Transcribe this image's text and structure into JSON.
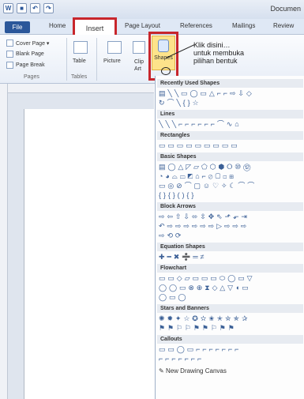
{
  "title_bar": {
    "document_title": "Documen"
  },
  "tabs": {
    "file": "File",
    "home": "Home",
    "insert": "Insert",
    "page_layout": "Page Layout",
    "references": "References",
    "mailings": "Mailings",
    "review": "Review"
  },
  "pages_group": {
    "cover_page": "Cover Page ▾",
    "blank_page": "Blank Page",
    "page_break": "Page Break",
    "group": "Pages"
  },
  "tables_group": {
    "table": "Table",
    "group": "Tables"
  },
  "illustrations": {
    "picture": "Picture",
    "clip_art": "Clip Art",
    "shapes": "Shapes"
  },
  "annotation": {
    "line1": "Klik disini…",
    "line2": "untuk membuka",
    "line3": "pilihan bentuk"
  },
  "gallery": {
    "sections": [
      {
        "title": "Recently Used Shapes",
        "rows": [
          "▤ ╲ ╲ ▭ ◯ ▭ △ ⌐ ⌐ ⇨ ⇩ ◇",
          "↻ ⌒ ╲ { } ☆"
        ]
      },
      {
        "title": "Lines",
        "rows": [
          "╲ ╲ ╲ ⌐ ⌐ ⌐ ⌐ ⌐ ⌐ ⌒ ∿ ⌂"
        ]
      },
      {
        "title": "Rectangles",
        "rows": [
          "▭ ▭ ▭ ▭ ▭ ▭ ▭ ▭ ▭"
        ]
      },
      {
        "title": "Basic Shapes",
        "rows": [
          "▤ ◯ △ ◸ ▱ ⬠ ⬡ ⬢ ⭘ ⑩ ⑫",
          "◔ ◕ ⌓ ▭ ◩ ⌂ ⌐ ⊘ ▢ ◻ ⊞",
          "▭ ◎ ⊘ ⌒ ▢ ☺ ♡ ✧ ☾ ⌒ ⌒",
          "{ } { } ( ) { }"
        ]
      },
      {
        "title": "Block Arrows",
        "rows": [
          "⇨ ⇦ ⇧ ⇩ ⬄ ⇳ ✥ ⇖ ⬏ ⬐ ⇥",
          "↶ ⇨ ⇨ ⇨ ⇨ ⇨ ⇨ ▷ ⇨ ⇨ ⇨",
          "⇨ ⟲ ⟳"
        ]
      },
      {
        "title": "Equation Shapes",
        "rows": [
          "✚ ━ ✖ ➗ ═ ≠"
        ]
      },
      {
        "title": "Flowchart",
        "rows": [
          "▭ ▭ ◇ ▱ ▭ ▭ ▭ ⬭ ◯ ▭ ▽",
          "◯ ◯ ▭ ⊗ ⊕ ⧗ ◇ △ ▽ ◖ ▭",
          "◯ ▭ ◯"
        ]
      },
      {
        "title": "Stars and Banners",
        "rows": [
          "✺ ✹ ✦ ☆ ✪ ✫ ✬ ✭ ✮ ✯ ✰",
          "⚑ ⚑ ⚐ ⚐ ⚑ ⚑ ⚐ ⚑ ⚑"
        ]
      },
      {
        "title": "Callouts",
        "rows": [
          "▭ ▭ ◯ ▭ ⌐ ⌐ ⌐ ⌐ ⌐ ⌐ ⌐",
          "⌐ ⌐ ⌐ ⌐ ⌐ ⌐ ⌐"
        ]
      }
    ],
    "new_canvas": "New Drawing Canvas"
  },
  "colors": {
    "accent": "#2b579a",
    "highlight": "#c8262c",
    "shapes_button": "#fde38a"
  }
}
